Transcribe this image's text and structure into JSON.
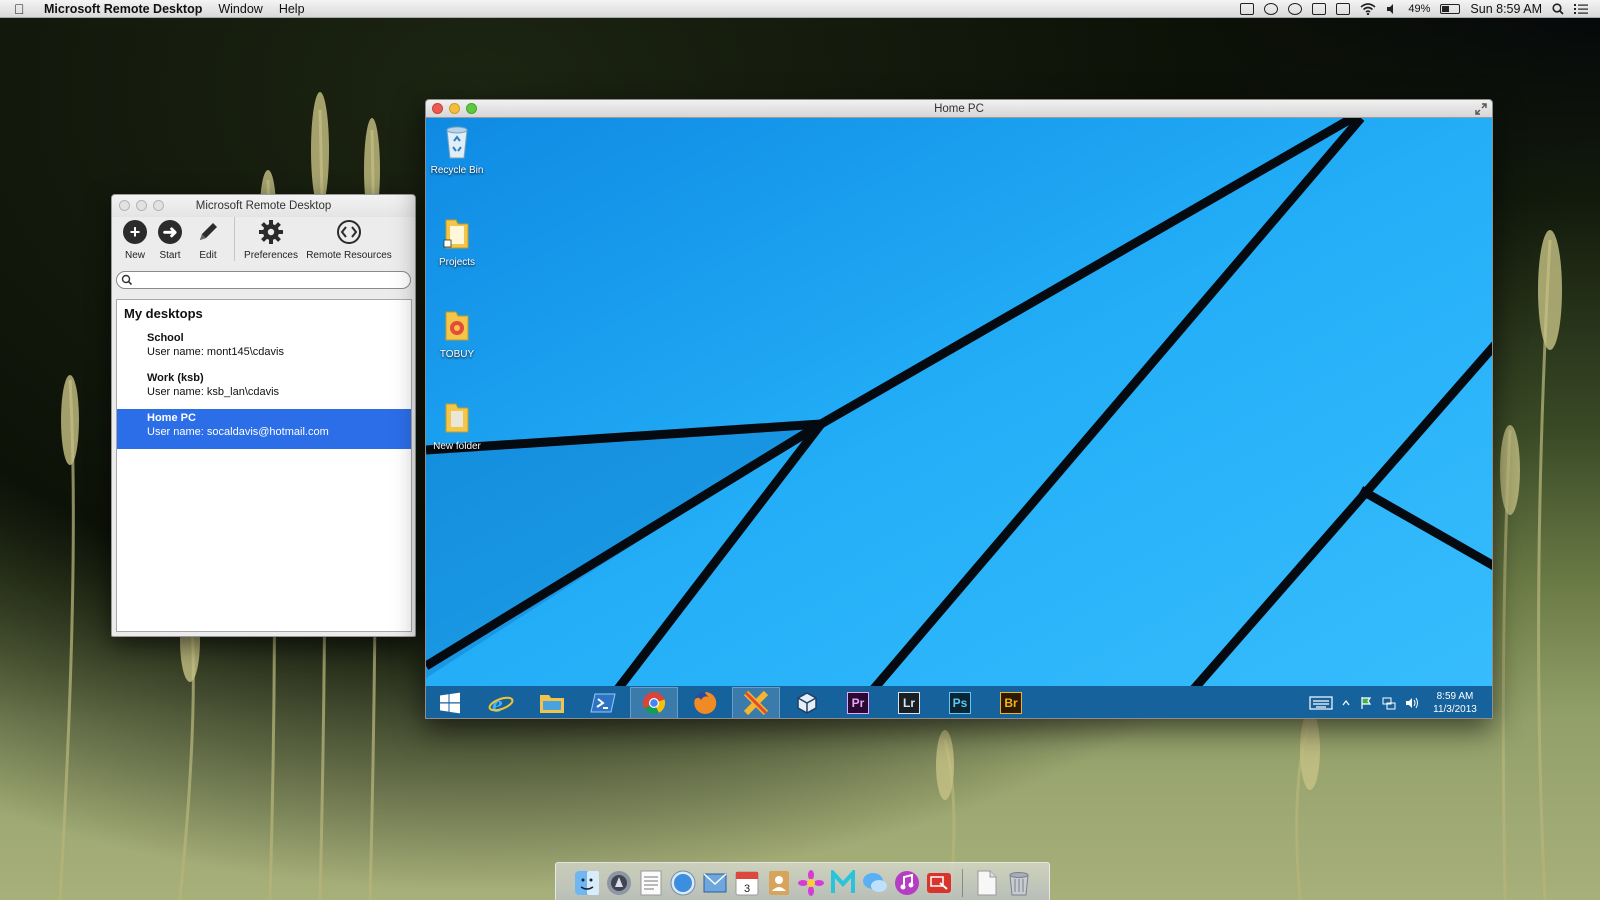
{
  "menubar": {
    "app_name": "Microsoft Remote Desktop",
    "menus": [
      "Window",
      "Help"
    ],
    "battery_text": "49%",
    "battery_level": 0.49,
    "clock": "Sun 8:59 AM"
  },
  "rd_window": {
    "title": "Microsoft Remote Desktop",
    "toolbar": {
      "new": "New",
      "start": "Start",
      "edit": "Edit",
      "preferences": "Preferences",
      "remote_resources": "Remote Resources"
    },
    "search_placeholder": "",
    "section_title": "My desktops",
    "desktops": [
      {
        "name": "School",
        "user": "User name: mont145\\cdavis",
        "selected": false
      },
      {
        "name": "Work (ksb)",
        "user": "User name: ksb_lan\\cdavis",
        "selected": false
      },
      {
        "name": "Home PC",
        "user": "User name: socaldavis@hotmail.com",
        "selected": true
      }
    ]
  },
  "pc_window": {
    "title": "Home PC",
    "desktop_icons": [
      {
        "label": "Recycle Bin",
        "icon": "recycle-bin-icon"
      },
      {
        "label": "Projects",
        "icon": "folder-icon"
      },
      {
        "label": "TOBUY",
        "icon": "folder-icon"
      },
      {
        "label": "New folder",
        "icon": "folder-icon"
      }
    ],
    "taskbar_apps": [
      "windows-start-icon",
      "internet-explorer-icon",
      "file-explorer-icon",
      "powershell-icon",
      "chrome-icon",
      "firefox-icon",
      "crossover-icon",
      "virtualbox-icon",
      "premiere-icon",
      "lightroom-icon",
      "photoshop-icon",
      "bridge-icon"
    ],
    "adobe": {
      "premiere": "Pr",
      "lightroom": "Lr",
      "photoshop": "Ps",
      "bridge": "Br"
    },
    "tray_time": "8:59 AM",
    "tray_date": "11/3/2013"
  },
  "colors": {
    "win_blue": "#1fa8f6",
    "selection": "#2c6ee8",
    "taskbar": "#145c96"
  }
}
